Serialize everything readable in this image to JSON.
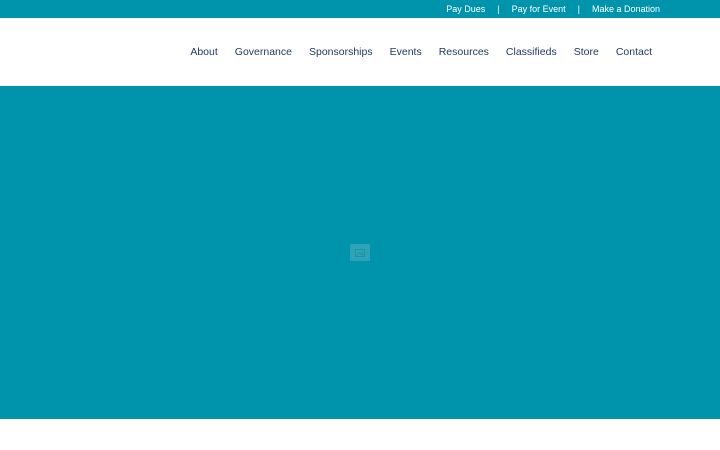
{
  "topbar": {
    "links": [
      "Pay Dues",
      "Pay for Event",
      "Make a Donation"
    ],
    "separator": "|"
  },
  "nav": {
    "items": [
      "About",
      "Governance",
      "Sponsorships",
      "Events",
      "Resources",
      "Classifieds",
      "Store",
      "Contact"
    ]
  },
  "hero": {
    "thumbnail_icon": "image-placeholder-icon"
  },
  "colors": {
    "brand_teal": "#0093ac",
    "nav_text": "#1e3a6b",
    "white": "#ffffff"
  }
}
